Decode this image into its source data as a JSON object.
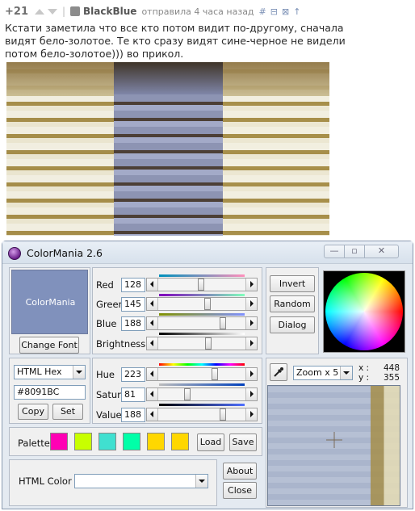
{
  "comment": {
    "score": "+21",
    "username": "BlackBlue",
    "meta": "отправила 4 часа назад",
    "actions": [
      "#",
      "⊟",
      "⊠",
      "↑"
    ],
    "text": "Кстати заметила что все кто потом видит по-другому, сначала видят бело-золотое. Те кто сразу видят сине-черное не видели потом бело-золотое))) во прикол.",
    "photo_alts": [
      "white-gold dress",
      "blue-black dress",
      "white-gold dress"
    ]
  },
  "window": {
    "title": "ColorMania 2.6",
    "controls": {
      "minimize": "—",
      "maximize": "▫",
      "close": "✕"
    }
  },
  "preview": {
    "label": "ColorMania",
    "color": "#8091BC",
    "change_font": "Change Font"
  },
  "rgb": {
    "red_label": "Red",
    "red": "128",
    "green_label": "Green",
    "green": "145",
    "blue_label": "Blue",
    "blue": "188",
    "brightness_label": "Brightness"
  },
  "hsv": {
    "hue_label": "Hue",
    "hue": "223",
    "sat_label": "Satur.",
    "sat": "81",
    "value_label": "Value",
    "value": "188"
  },
  "format": {
    "selected": "HTML Hex",
    "hex": "#8091BC",
    "copy": "Copy",
    "set": "Set"
  },
  "buttons": {
    "invert": "Invert",
    "random": "Random",
    "dialog": "Dialog",
    "load": "Load",
    "save": "Save",
    "about": "About",
    "close": "Close"
  },
  "palette": {
    "label": "Palette",
    "colors": [
      "#ff00b4",
      "#c8ff00",
      "#40e0d0",
      "#00ffa8",
      "#ffd700",
      "#ffd700"
    ]
  },
  "html_color": {
    "label": "HTML Color",
    "value": ""
  },
  "zoom": {
    "selected": "Zoom x 5",
    "x_label": "x :",
    "x": "448",
    "y_label": "y :",
    "y": "355"
  }
}
